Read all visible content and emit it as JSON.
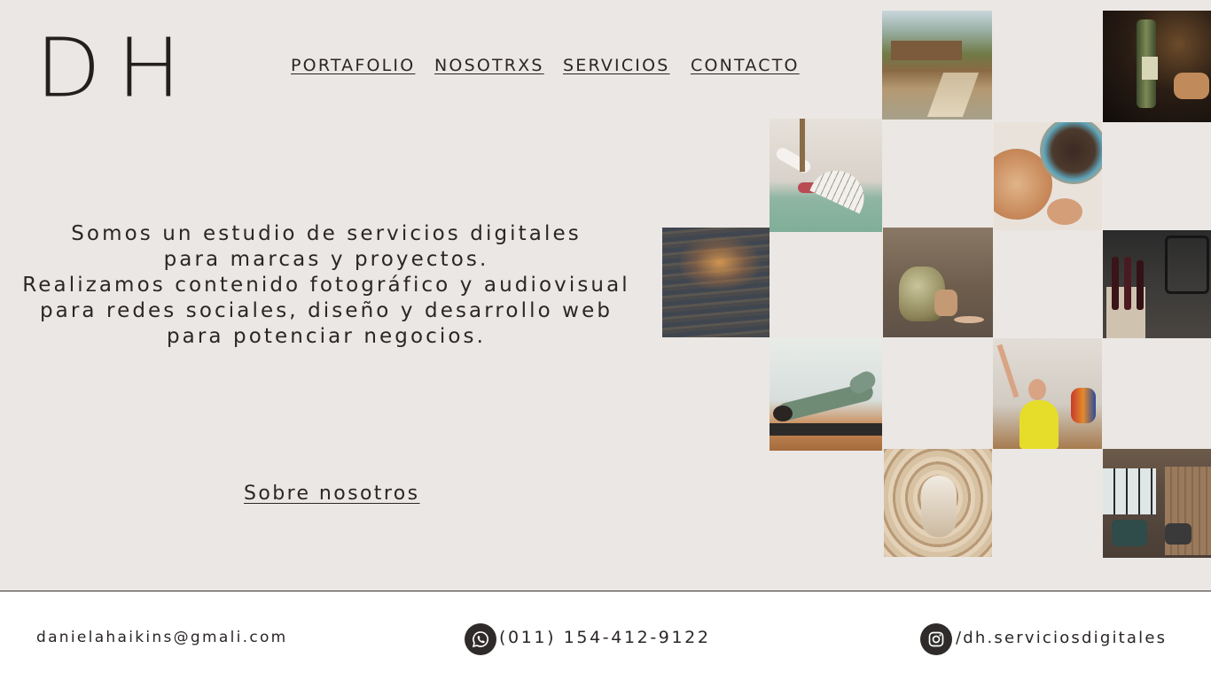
{
  "brand": {
    "logo_text": "DH"
  },
  "nav": {
    "items": [
      {
        "label": "PORTAFOLIO"
      },
      {
        "label": "NOSOTRXS"
      },
      {
        "label": "SERVICIOS"
      },
      {
        "label": "CONTACTO"
      }
    ]
  },
  "hero": {
    "tagline_lines": [
      "Somos un estudio de servicios digitales",
      "para marcas y proyectos.",
      "Realizamos contenido fotográfico y audiovisual",
      "para redes sociales, diseño y desarrollo web",
      "para potenciar negocios."
    ],
    "about_link": "Sobre nosotros"
  },
  "gallery": {
    "photos": [
      {
        "name": "garden-cabin-photo"
      },
      {
        "name": "wine-bottle-photo"
      },
      {
        "name": "dancer-fan-photo"
      },
      {
        "name": "ceramic-plates-photo"
      },
      {
        "name": "sea-sunset-photo"
      },
      {
        "name": "ceramic-jar-photo"
      },
      {
        "name": "wine-cellar-photo"
      },
      {
        "name": "pilates-reformer-photo"
      },
      {
        "name": "dance-class-photo"
      },
      {
        "name": "wooden-interior-photo"
      },
      {
        "name": "restaurant-interior-photo"
      }
    ]
  },
  "footer": {
    "email": "danielahaikins@gmali.com",
    "phone": "(011) 154-412-9122",
    "instagram": "/dh.serviciosdigitales"
  },
  "colors": {
    "hero_background": "#ebe7e4",
    "text": "#2b2626",
    "footer_background": "#ffffff",
    "icon_background": "#2f2b2b"
  }
}
